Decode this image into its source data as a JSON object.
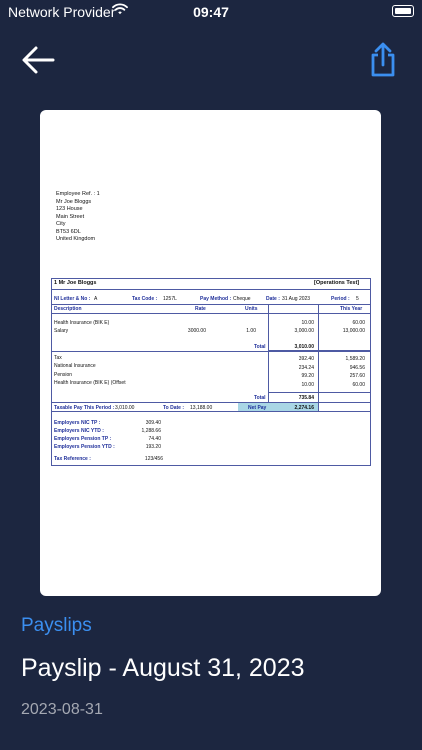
{
  "status_bar": {
    "carrier": "Network Provider",
    "time": "09:47"
  },
  "document": {
    "address_lines": [
      "Employee Ref. : 1",
      "Mr Joe Bloggs",
      "123 House",
      "Main Street",
      "City",
      "BT53 6DL",
      "United Kingdom"
    ],
    "header_name": "1 Mr Joe Bloggs",
    "header_company": "[Operations Test]",
    "ni_label": "NI Letter & No :",
    "ni_value": "A",
    "tax_code_label": "Tax Code :",
    "tax_code_value": "1257L",
    "pay_method_label": "Pay Method :",
    "pay_method_value": "Cheque",
    "date_label": "Date :",
    "date_value": "31 Aug 2023",
    "period_label": "Period :",
    "period_value": "5",
    "col_description": "Description",
    "col_rate": "Rate",
    "col_units": "Units",
    "col_this_year": "This Year",
    "payments": [
      {
        "desc": "Health Insurance (BIK E)",
        "rate": "",
        "units": "",
        "amount": "10.00",
        "ytd": "60.00"
      },
      {
        "desc": "Salary",
        "rate": "3000.00",
        "units": "1.00",
        "amount": "3,000.00",
        "ytd": "13,000.00"
      }
    ],
    "total_label": "Total",
    "payments_total": "3,010.00",
    "deductions": [
      {
        "desc": "Tax",
        "amount": "392.40",
        "ytd": "1,589.20"
      },
      {
        "desc": "National Insurance",
        "amount": "234.24",
        "ytd": "946.56"
      },
      {
        "desc": "Pension",
        "amount": "99.20",
        "ytd": "257.60"
      },
      {
        "desc": "Health Insurance (BIK E) (Offset",
        "amount": "10.00",
        "ytd": "60.00"
      }
    ],
    "deductions_total": "735.84",
    "taxable_label": "Taxable Pay This Period :",
    "taxable_value": "3,010.00",
    "to_date_label": "To Date :",
    "to_date_value": "13,188.00",
    "net_pay_label": "Net Pay",
    "net_pay_value": "2,274.16",
    "employer": [
      {
        "label": "Employers NIC TP :",
        "value": "309.40"
      },
      {
        "label": "Employers NIC YTD :",
        "value": "1,288.66"
      },
      {
        "label": "Employers Pension TP :",
        "value": "74.40"
      },
      {
        "label": "Employers Pension YTD :",
        "value": "193.20"
      }
    ],
    "tax_ref_label": "Tax Reference :",
    "tax_ref_value": "123/456"
  },
  "section_label": "Payslips",
  "title": "Payslip - August 31, 2023",
  "date": "2023-08-31",
  "colors": {
    "background": "#1c2640",
    "accent": "#3b8ff0",
    "net_pay_highlight": "#a9d6e5"
  }
}
